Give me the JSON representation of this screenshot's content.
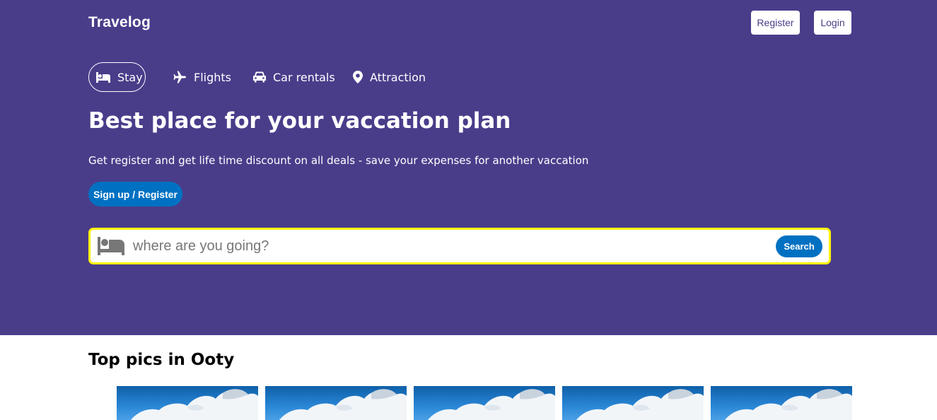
{
  "header": {
    "logo": "Travelog",
    "register_label": "Register",
    "login_label": "Login"
  },
  "nav": {
    "tabs": [
      {
        "label": "Stay",
        "icon": "bed-icon",
        "active": true
      },
      {
        "label": "Flights",
        "icon": "plane-icon",
        "active": false
      },
      {
        "label": "Car rentals",
        "icon": "car-icon",
        "active": false
      },
      {
        "label": "Attraction",
        "icon": "map-pin-icon",
        "active": false
      }
    ]
  },
  "hero": {
    "title": "Best place for your vaccation plan",
    "subtitle": "Get register and get life time discount on all deals - save your expenses for another vaccation",
    "signup_label": "Sign up / Register"
  },
  "search": {
    "icon": "bed-icon",
    "placeholder": "where are you going?",
    "value": "",
    "button_label": "Search"
  },
  "top_picks": {
    "title": "Top pics in Ooty",
    "cards": [
      {
        "image": "sky-clouds-image"
      },
      {
        "image": "sky-clouds-image"
      },
      {
        "image": "sky-clouds-image"
      },
      {
        "image": "sky-clouds-image"
      },
      {
        "image": "sky-clouds-image"
      }
    ]
  },
  "colors": {
    "hero_bg": "#493d8a",
    "accent_blue": "#0071c2",
    "search_border": "#fff200",
    "white": "#ffffff"
  }
}
